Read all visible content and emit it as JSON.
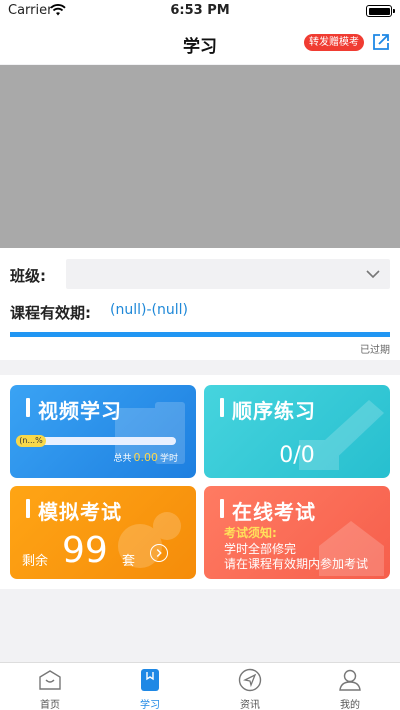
{
  "status_bar": {
    "carrier": "Carrier",
    "time": "6:53 PM"
  },
  "nav": {
    "title": "学习",
    "share_badge": "转发赠模考",
    "share_icon": "share-icon"
  },
  "class_select": {
    "label": "班级:",
    "value": ""
  },
  "validity": {
    "label": "课程有效期:",
    "value": "(null)-(null)",
    "status": "已过期",
    "progress": 1.0
  },
  "cards": {
    "video": {
      "title": "视频学习",
      "progress_label": "(n...%",
      "total_prefix": "总共",
      "total_value": "0.00",
      "total_suffix": "学时"
    },
    "sequence": {
      "title": "顺序练习",
      "count": "0/0"
    },
    "mock": {
      "title": "模拟考试",
      "rest_prefix": "剩余",
      "rest_value": "99",
      "rest_suffix": "套"
    },
    "online": {
      "title": "在线考试",
      "notice_title": "考试须知:",
      "notice_lines": [
        "学时全部修完",
        "请在课程有效期内参加考试"
      ]
    }
  },
  "colors": {
    "accent": "#1e88e5",
    "video": "#2d93ee",
    "sequence": "#36c9d6",
    "mock": "#fb9a10",
    "online": "#f86e58",
    "badge": "#f03c32"
  },
  "tabs": [
    {
      "label": "首页",
      "icon": "home-icon",
      "active": false
    },
    {
      "label": "学习",
      "icon": "bookmark-icon",
      "active": true
    },
    {
      "label": "资讯",
      "icon": "compass-icon",
      "active": false
    },
    {
      "label": "我的",
      "icon": "user-icon",
      "active": false
    }
  ]
}
